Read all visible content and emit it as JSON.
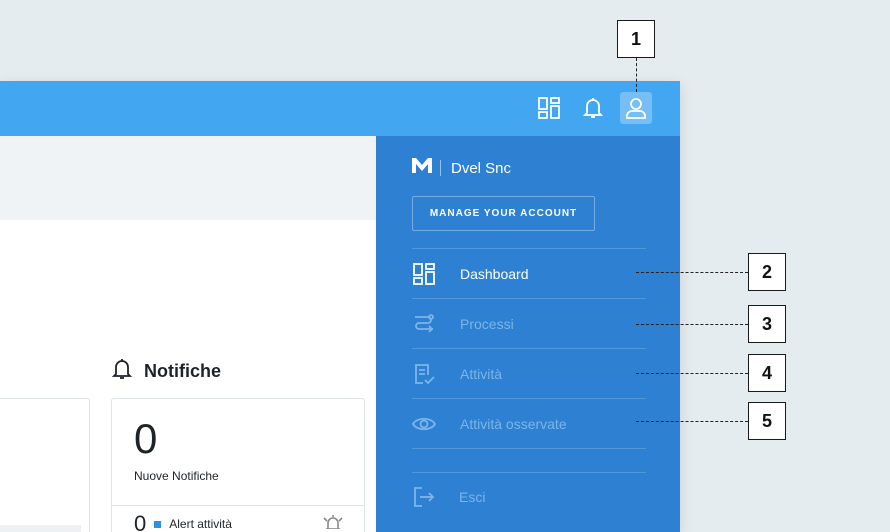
{
  "topbar": {
    "icons": [
      "dashboard-icon",
      "bell-icon",
      "user-icon"
    ],
    "colors": {
      "bar": "#42a6f1",
      "panel": "#2d80d2"
    }
  },
  "notifications": {
    "title": "Notifiche",
    "count": "0",
    "count_label": "Nuove Notifiche",
    "alert_count": "0",
    "alert_label": "Alert attività"
  },
  "account_panel": {
    "company": "Dvel Snc",
    "manage_button": "MANAGE YOUR ACCOUNT",
    "menu": [
      {
        "label": "Dashboard",
        "icon": "dashboard-icon",
        "active": true
      },
      {
        "label": "Processi",
        "icon": "process-icon",
        "active": false
      },
      {
        "label": "Attività",
        "icon": "task-icon",
        "active": false
      },
      {
        "label": "Attività osservate",
        "icon": "eye-icon",
        "active": false
      }
    ],
    "logout": "Esci"
  },
  "callouts": [
    "1",
    "2",
    "3",
    "4",
    "5"
  ]
}
